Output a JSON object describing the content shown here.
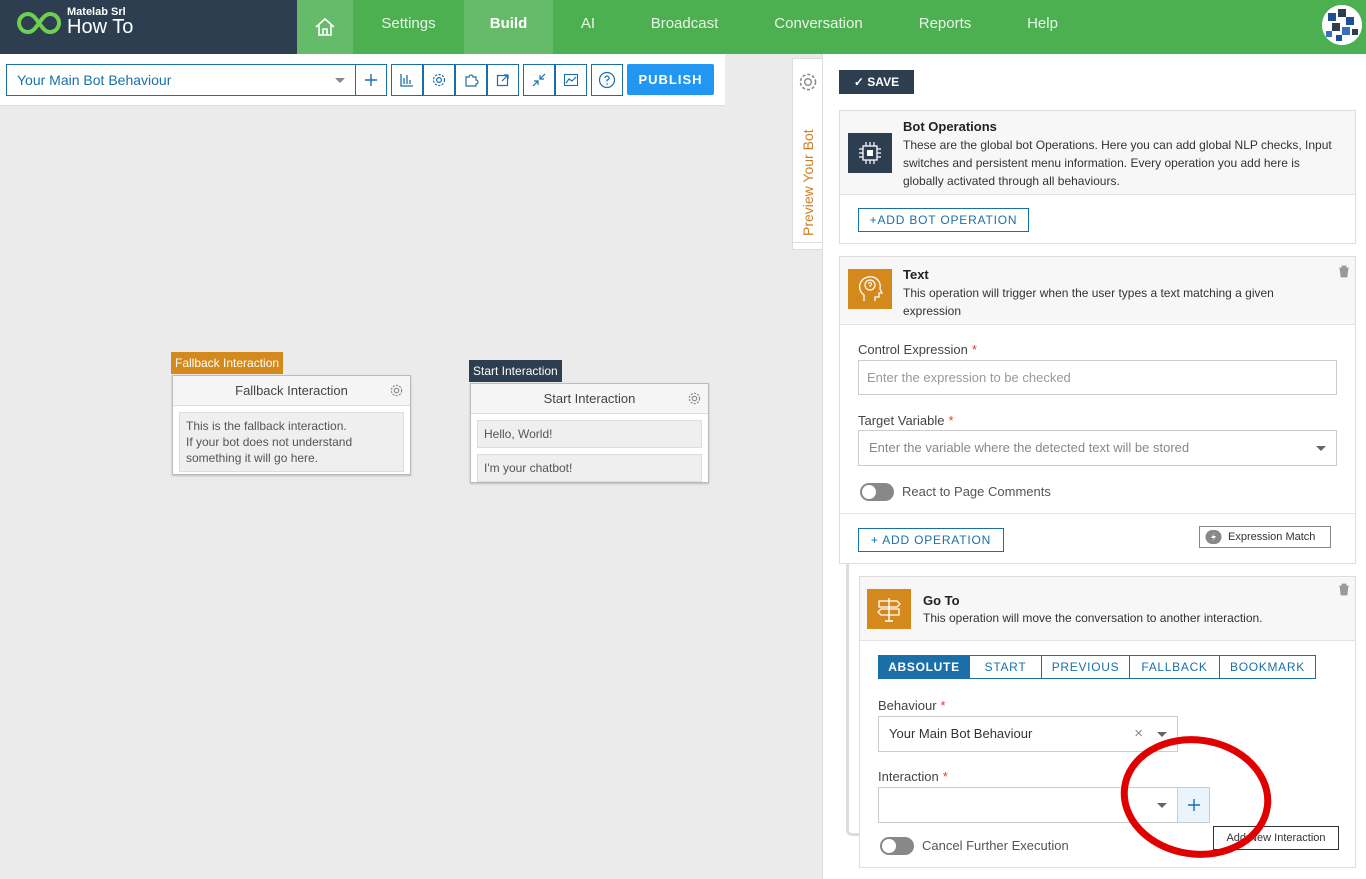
{
  "brand": {
    "company": "Matelab Srl",
    "title": "How To"
  },
  "nav": [
    {
      "label": "Settings",
      "active": false
    },
    {
      "label": "Build",
      "active": true
    },
    {
      "label": "AI",
      "active": false
    },
    {
      "label": "Broadcast",
      "active": false
    },
    {
      "label": "Conversation",
      "active": false
    },
    {
      "label": "Reports",
      "active": false
    },
    {
      "label": "Help",
      "active": false
    }
  ],
  "toolbar": {
    "behaviour": "Your Main Bot Behaviour",
    "icons": [
      "add-icon",
      "chart-icon",
      "gear-icon",
      "puzzle-icon",
      "export-icon",
      "compress-icon",
      "analytics-icon",
      "help-icon"
    ],
    "publish": "PUBLISH"
  },
  "canvas": {
    "fallback": {
      "tag": "Fallback Interaction",
      "title": "Fallback Interaction",
      "messages": [
        "This is the fallback interaction.\nIf your bot does not understand something it will go here."
      ]
    },
    "start": {
      "tag": "Start Interaction",
      "title": "Start Interaction",
      "messages": [
        "Hello, World!",
        "I'm your chatbot!"
      ]
    }
  },
  "side": {
    "preview": "Preview Your Bot"
  },
  "panel": {
    "save": "SAVE",
    "bot_operations": {
      "title": "Bot Operations",
      "description": "These are the global bot Operations. Here you can add global NLP checks, Input switches and persistent menu information. Every operation you add here is globally activated through all behaviours.",
      "add_button": "+ADD BOT OPERATION"
    },
    "text_op": {
      "title": "Text",
      "description": "This operation will trigger when the user types a text matching a given expression",
      "control_label": "Control Expression",
      "control_placeholder": "Enter the expression to be checked",
      "target_label": "Target Variable",
      "target_placeholder": "Enter the variable where the detected text will be stored",
      "react_label": "React to Page Comments",
      "add_operation": "+ ADD OPERATION",
      "expression_match": "Expression Match"
    },
    "goto_op": {
      "title": "Go To",
      "description": "This operation will move the conversation to another interaction.",
      "tabs": [
        "ABSOLUTE",
        "START",
        "PREVIOUS",
        "FALLBACK",
        "BOOKMARK"
      ],
      "active_tab": "ABSOLUTE",
      "behaviour_label": "Behaviour",
      "behaviour_value": "Your Main Bot Behaviour",
      "clear": "×",
      "interaction_label": "Interaction",
      "interaction_value": "",
      "cancel_label": "Cancel Further Execution",
      "tooltip": "Add New Interaction"
    }
  },
  "colors": {
    "topbar": "#4caf50",
    "brand_bg": "#2c3e50",
    "accent": "#1b6fa8",
    "publish": "#2196f3",
    "fallback_tag": "#d4891c",
    "start_tag": "#2c3e50",
    "annotation": "#e00000"
  }
}
